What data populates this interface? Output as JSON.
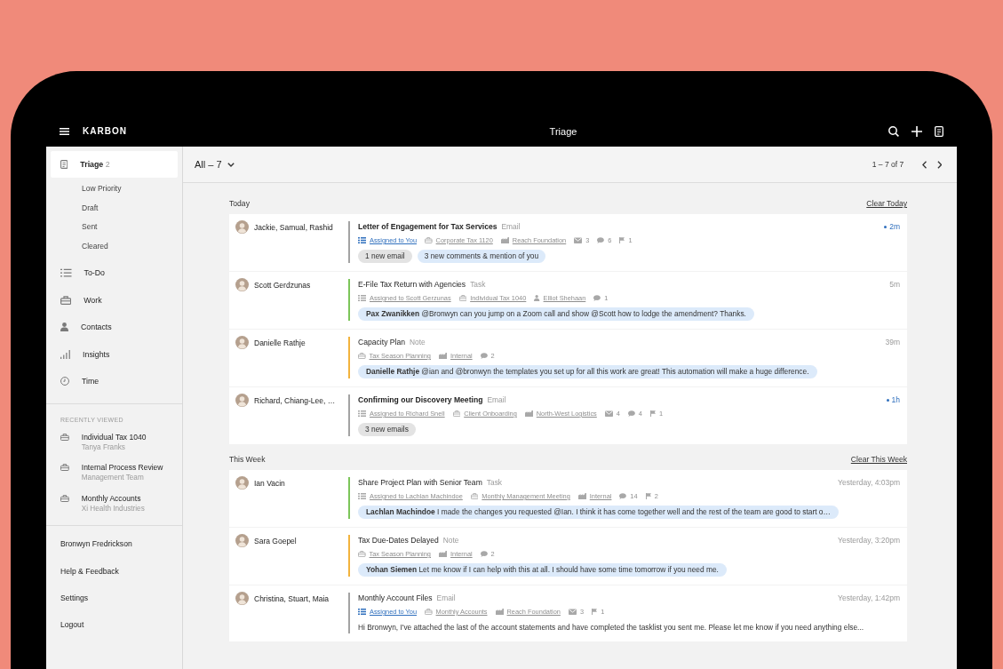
{
  "app_bar": {
    "brand": "KARBON",
    "title": "Triage"
  },
  "sidebar": {
    "nav": [
      {
        "label": "Triage",
        "count": "2",
        "selected": true,
        "children": [
          {
            "label": "Low Priority",
            "selected": false
          },
          {
            "label": "Draft",
            "selected": false
          },
          {
            "label": "Sent",
            "selected": false
          },
          {
            "label": "Cleared",
            "selected": false
          }
        ]
      },
      {
        "label": "To-Do",
        "selected": false
      },
      {
        "label": "Work",
        "selected": false
      },
      {
        "label": "Contacts",
        "selected": false
      },
      {
        "label": "Insights",
        "selected": false
      },
      {
        "label": "Time",
        "selected": false
      }
    ],
    "recent": {
      "heading": "RECENTLY VIEWED",
      "items": [
        {
          "title": "Individual Tax 1040",
          "subtitle": "Tanya Franks"
        },
        {
          "title": "Internal Process Review",
          "subtitle": "Management Team"
        },
        {
          "title": "Monthly Accounts",
          "subtitle": "Xi Health Industries"
        }
      ]
    },
    "links": [
      "Bronwyn Fredrickson",
      "Help & Feedback",
      "Settings",
      "Logout"
    ]
  },
  "toolbar": {
    "filter": "All – 7",
    "range": "1 – 7 of 7"
  },
  "sections": [
    {
      "title": "Today",
      "action": "Clear Today",
      "rows": [
        {
          "names": "Jackie, Samual, Rashid",
          "title": "Letter of Engagement for Tax Services",
          "type": "Email",
          "color": "#a3a3a3",
          "unread": true,
          "time": "2m",
          "meta": [
            {
              "kind": "assignee",
              "text": "Assigned to You",
              "highlighted": true
            },
            {
              "kind": "work",
              "text": "Corporate Tax 1120",
              "highlighted": false
            },
            {
              "kind": "client",
              "text": "Reach Foundation",
              "highlighted": false
            },
            {
              "kind": "emails",
              "text": "3",
              "highlighted": false
            },
            {
              "kind": "comments",
              "text": "6",
              "highlighted": false
            },
            {
              "kind": "tasks",
              "text": "1",
              "highlighted": false
            }
          ],
          "footer": {
            "kind": "chips",
            "chips": [
              {
                "text": "1 new email",
                "color": "#e3e3e3"
              },
              {
                "text": "3 new comments & mention of you",
                "color": "#dceafa"
              }
            ]
          }
        },
        {
          "names": "Scott Gerdzunas",
          "title": "E-File Tax Return with Agencies",
          "type": "Task",
          "color": "#7cc55a",
          "unread": false,
          "time": "5m",
          "meta": [
            {
              "kind": "assignee",
              "text": "Assigned to Scott Gerzunas",
              "highlighted": false
            },
            {
              "kind": "work",
              "text": "Individual Tax 1040",
              "highlighted": false
            },
            {
              "kind": "contact",
              "text": "Elliot Shehaan",
              "highlighted": false
            },
            {
              "kind": "comments",
              "text": "1",
              "highlighted": false
            }
          ],
          "footer": {
            "kind": "comment",
            "text": "**Pax Zwanikken** @Bronwyn can you jump on a Zoom call and show @Scott how to lodge the amendment? Thanks."
          }
        },
        {
          "names": "Danielle Rathje",
          "title": "Capacity Plan",
          "type": "Note",
          "color": "#f2b33d",
          "unread": false,
          "time": "39m",
          "meta": [
            {
              "kind": "work",
              "text": "Tax Season Planning",
              "highlighted": false
            },
            {
              "kind": "client",
              "text": "Internal",
              "highlighted": false
            },
            {
              "kind": "comments",
              "text": "2",
              "highlighted": false
            }
          ],
          "footer": {
            "kind": "comment",
            "text": "**Danielle Rathje** @ian and @bronwyn the templates you set up for all this work are great! This automation will make a huge difference."
          }
        },
        {
          "names": "Richard, Chiang-Lee, …",
          "title": "Confirming our Discovery Meeting",
          "type": "Email",
          "color": "#a3a3a3",
          "unread": true,
          "time": "1h",
          "meta": [
            {
              "kind": "assignee",
              "text": "Assigned to Richard Snell",
              "highlighted": false
            },
            {
              "kind": "work",
              "text": "Client Onboarding",
              "highlighted": false
            },
            {
              "kind": "client",
              "text": "North-West Logistics",
              "highlighted": false
            },
            {
              "kind": "emails",
              "text": "4",
              "highlighted": false
            },
            {
              "kind": "comments",
              "text": "4",
              "highlighted": false
            },
            {
              "kind": "tasks",
              "text": "1",
              "highlighted": false
            }
          ],
          "footer": {
            "kind": "chips",
            "chips": [
              {
                "text": "3 new emails",
                "color": "#e3e3e3"
              }
            ]
          }
        }
      ]
    },
    {
      "title": "This Week",
      "action": "Clear This Week",
      "rows": [
        {
          "names": "Ian Vacin",
          "title": "Share Project Plan with Senior Team",
          "type": "Task",
          "color": "#7cc55a",
          "unread": false,
          "time": "Yesterday, 4:03pm",
          "meta": [
            {
              "kind": "assignee",
              "text": "Assigned to Lachlan Machindoe",
              "highlighted": false
            },
            {
              "kind": "work",
              "text": "Monthly Management Meeting",
              "highlighted": false
            },
            {
              "kind": "client",
              "text": "Internal",
              "highlighted": false
            },
            {
              "kind": "comments",
              "text": "14",
              "highlighted": false
            },
            {
              "kind": "tasks",
              "text": "2",
              "highlighted": false
            }
          ],
          "footer": {
            "kind": "comment",
            "text": "**Lachlan Machindoe** I made the changes you requested @Ian. I think it has come together well and the rest of the team are good to start o…"
          }
        },
        {
          "names": "Sara Goepel",
          "title": "Tax Due-Dates Delayed",
          "type": "Note",
          "color": "#f2b33d",
          "unread": false,
          "time": "Yesterday, 3:20pm",
          "meta": [
            {
              "kind": "work",
              "text": "Tax Season Planning",
              "highlighted": false
            },
            {
              "kind": "client",
              "text": "Internal",
              "highlighted": false
            },
            {
              "kind": "comments",
              "text": "2",
              "highlighted": false
            }
          ],
          "footer": {
            "kind": "comment",
            "text": "**Yohan Siemen** Let me know if I can help with this at all. I should have some time tomorrow if you need me."
          }
        },
        {
          "names": "Christina, Stuart, Maia",
          "title": "Monthly Account Files",
          "type": "Email",
          "color": "#a3a3a3",
          "unread": false,
          "time": "Yesterday, 1:42pm",
          "meta": [
            {
              "kind": "assignee",
              "text": "Assigned to You",
              "highlighted": true
            },
            {
              "kind": "work",
              "text": "Monthly Accounts",
              "highlighted": false
            },
            {
              "kind": "client",
              "text": "Reach Foundation",
              "highlighted": false
            },
            {
              "kind": "emails",
              "text": "3",
              "highlighted": false
            },
            {
              "kind": "tasks",
              "text": "1",
              "highlighted": false
            }
          ],
          "footer": {
            "kind": "preview",
            "text": "Hi Bronwyn, I've attached the last of the account statements and have completed the tasklist you sent me. Please let me know if you need anything else..."
          }
        }
      ]
    }
  ]
}
